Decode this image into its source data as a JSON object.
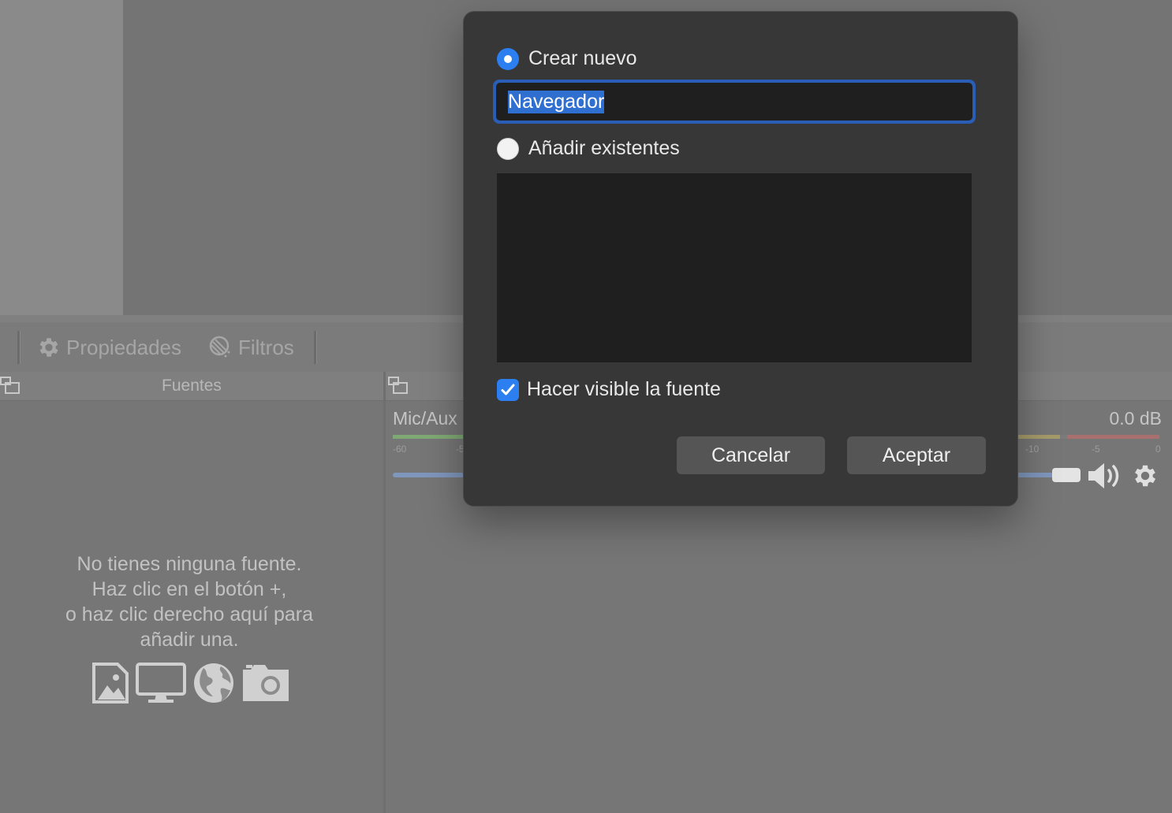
{
  "toolbar": {
    "properties_label": "Propiedades",
    "filters_label": "Filtros"
  },
  "sources_dock": {
    "title": "Fuentes",
    "empty_lines": [
      "No tienes ninguna fuente.",
      "Haz clic en el botón +,",
      "o haz clic derecho aquí para",
      "añadir una."
    ]
  },
  "mixer": {
    "channel_label": "Mic/Aux",
    "level_label": "0.0 dB",
    "ticks_left": [
      "-60",
      "-5"
    ],
    "ticks_right": [
      "-10",
      "-5",
      "0"
    ]
  },
  "dialog": {
    "create_new_label": "Crear nuevo",
    "name_value": "Navegador",
    "add_existing_label": "Añadir existentes",
    "visible_label": "Hacer visible la fuente",
    "visible_checked": true,
    "cancel_label": "Cancelar",
    "accept_label": "Aceptar"
  },
  "colors": {
    "accent": "#2b7ff0",
    "dialog_bg": "#373737",
    "input_bg": "#1f1f1f"
  }
}
